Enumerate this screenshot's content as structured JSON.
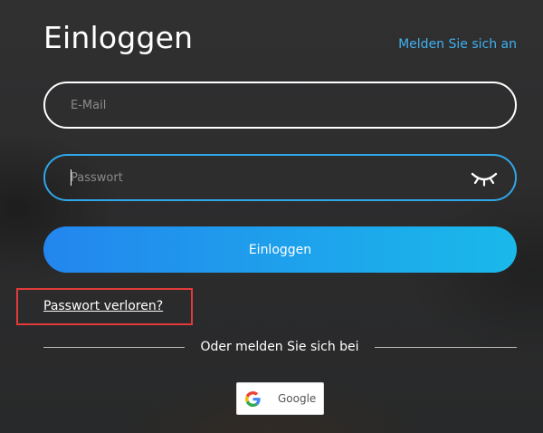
{
  "header": {
    "title": "Einloggen",
    "signup_link": "Melden Sie sich an"
  },
  "form": {
    "email": {
      "placeholder": "E-Mail",
      "value": ""
    },
    "password": {
      "placeholder": "Passwort",
      "value": "",
      "toggle_icon": "eye-closed-icon"
    },
    "submit_label": "Einloggen",
    "forgot_label": "Passwort verloren?"
  },
  "social": {
    "divider_text": "Oder melden Sie sich bei",
    "google_label": "Google",
    "google_icon": "google-g-icon"
  },
  "colors": {
    "background": "#2d2d2e",
    "accent_link": "#3fb0f0",
    "focus_border": "#2fa6e8",
    "button_gradient_start": "#2386ee",
    "button_gradient_end": "#1ab9ea",
    "highlight_box": "#e23a3a"
  }
}
